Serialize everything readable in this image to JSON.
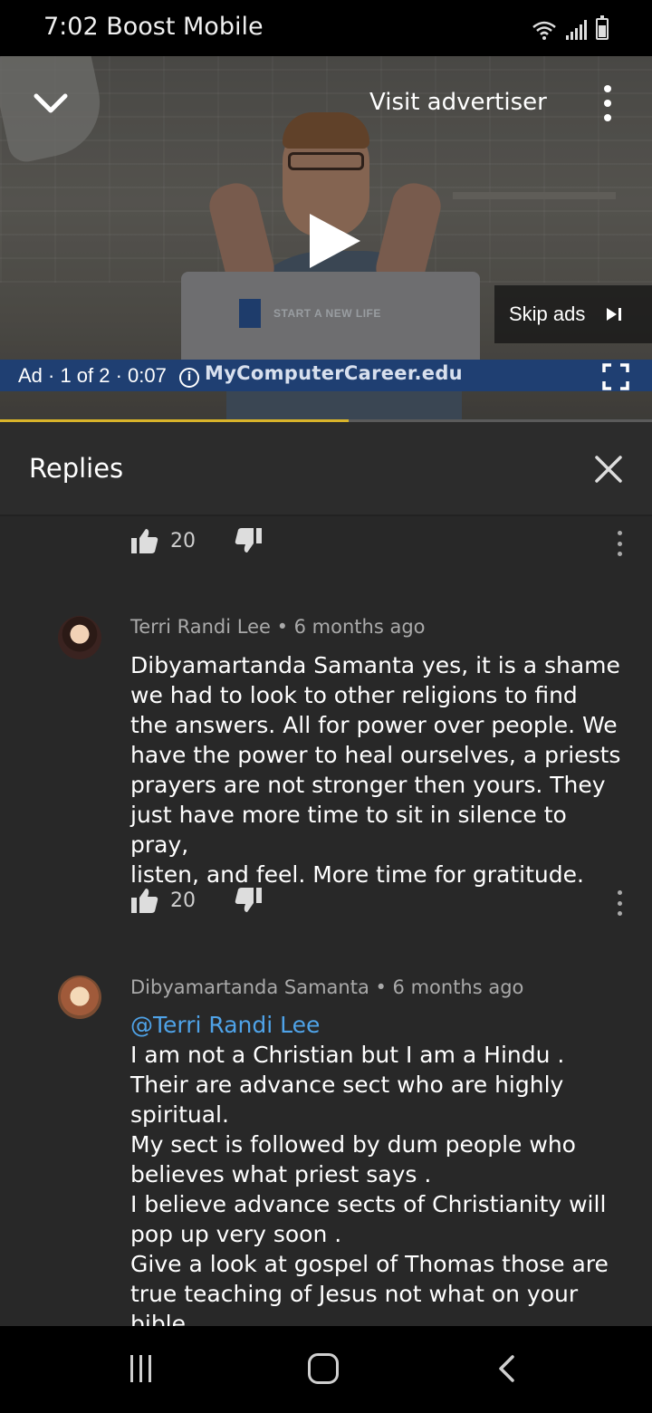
{
  "status_bar": {
    "time_carrier": "7:02 Boost Mobile",
    "icons": [
      "wifi-icon",
      "signal-icon",
      "battery-icon"
    ]
  },
  "video_ad": {
    "visit_advertiser": "Visit advertiser",
    "skip_label": "Skip ads",
    "ad_counter": "Ad · 1 of 2 · 0:07",
    "advertiser_domain": "MyComputerCareer.edu",
    "laptop_text": "START A NEW LIFE",
    "progress_fraction": 0.535,
    "progress_color": "#d9b42a"
  },
  "replies_panel": {
    "title": "Replies",
    "top_actions": {
      "likes": "20"
    },
    "comments": [
      {
        "author": "Terri Randi Lee",
        "time": "6 months ago",
        "meta": "Terri Randi Lee • 6 months ago",
        "lines": [
          "Dibyamartanda Samanta yes, it is a shame",
          "we had to look to other religions to find",
          "the answers. All for power over people. We",
          "have the power to heal ourselves, a priests",
          "prayers are not stronger then yours. They",
          "just have more time to sit in silence to pray,",
          "listen, and feel. More time for gratitude."
        ],
        "likes": "20"
      },
      {
        "author": "Dibyamartanda Samanta",
        "time": "6 months ago",
        "meta": "Dibyamartanda Samanta • 6 months ago",
        "mention": "@Terri Randi Lee",
        "lines": [
          "I am not a Christian but I am a Hindu .",
          "Their are advance sect who are highly",
          "spiritual.",
          "My sect is followed by dum people who",
          "believes what priest says .",
          "I believe advance sects of Christianity will",
          "pop up very soon .",
          "Give a look at gospel of Thomas those are",
          "true teaching of Jesus not what on your",
          "bible ."
        ]
      }
    ]
  },
  "colors": {
    "panel_bg": "#282828",
    "mention": "#4fa3e8",
    "meta_text": "#aaaaaa"
  }
}
